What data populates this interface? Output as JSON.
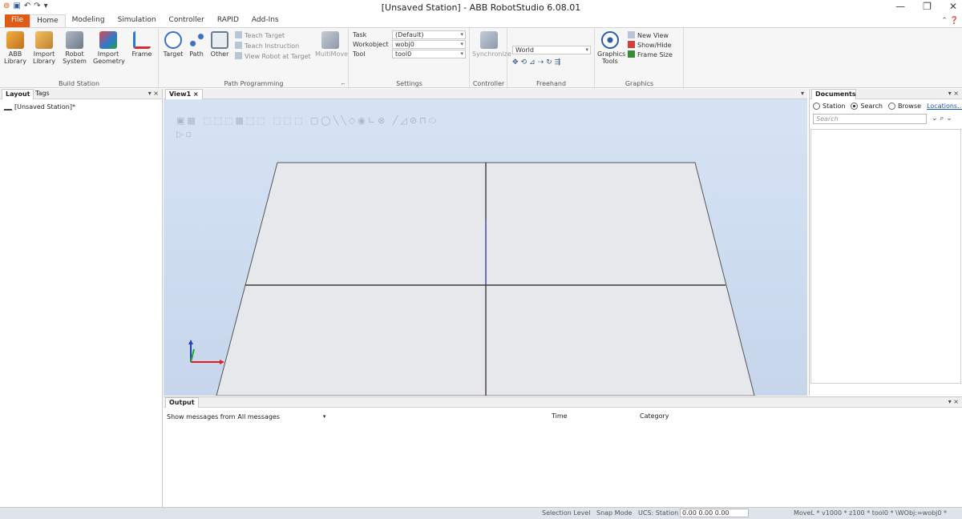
{
  "window": {
    "title": "[Unsaved Station] - ABB RobotStudio 6.08.01",
    "qat_icons": [
      "app-icon",
      "save-icon",
      "undo-icon",
      "redo-icon",
      "customize-icon"
    ],
    "controls": {
      "minimize": "—",
      "restore": "❐",
      "close": "✕"
    }
  },
  "tabs": [
    {
      "label": "File"
    },
    {
      "label": "Home"
    },
    {
      "label": "Modeling"
    },
    {
      "label": "Simulation"
    },
    {
      "label": "Controller"
    },
    {
      "label": "RAPID"
    },
    {
      "label": "Add-Ins"
    }
  ],
  "help_glyph": "⌃ ❓",
  "ribbon": {
    "build_station": {
      "label": "Build Station",
      "abb_library": "ABB Library",
      "import_library": "Import Library",
      "robot_system": "Robot System",
      "import_geometry": "Import Geometry",
      "frame": "Frame"
    },
    "path_programming": {
      "label": "Path Programming",
      "target": "Target",
      "path": "Path",
      "other": "Other",
      "teach_target": "Teach Target",
      "teach_instruction": "Teach Instruction",
      "view_robot_at_target": "View Robot at Target",
      "multimove": "MultiMove",
      "launcher": "⌐"
    },
    "settings": {
      "label": "Settings",
      "task": "Task",
      "workobject": "Workobject",
      "tool": "Tool",
      "task_value": "(Default)",
      "workobject_value": "wobj0",
      "tool_value": "tool0"
    },
    "controller": {
      "label": "Controller",
      "synchronize": "Synchronize"
    },
    "freehand": {
      "label": "Freehand",
      "reference_value": "World"
    },
    "graphics": {
      "label": "Graphics",
      "graphics_tools": "Graphics Tools",
      "new_view": "New View",
      "show_hide": "Show/Hide",
      "frame_size": "Frame Size"
    }
  },
  "layout_panel": {
    "tabs": [
      "Layout",
      "Tags"
    ],
    "pin": "▾ ×",
    "tree_item": "[Unsaved Station]*"
  },
  "view_panel": {
    "tab": "View1",
    "close": "×",
    "menu": "▾"
  },
  "documents_panel": {
    "tab": "Documents",
    "pin": "▾ ×",
    "radio_station": "Station",
    "radio_search": "Search",
    "radio_browse": "Browse",
    "locations_link": "Locations...",
    "search_placeholder": "Search",
    "search_icons": "⌄  ⌕  ⌄"
  },
  "output_panel": {
    "tab": "Output",
    "pin": "▾ ×",
    "show_messages_label": "Show messages from",
    "filter_value": "All messages",
    "columns": [
      "Time",
      "Category"
    ]
  },
  "statusbar": {
    "selection_level": "Selection Level",
    "snap_mode": "Snap Mode",
    "ucs": "UCS: Station",
    "coords": "0.00  0.00  0.00",
    "move_settings": "MoveL  *  v1000  *  z100  *  tool0  *  \\WObj:=wobj0  *"
  },
  "colors": {
    "file_tab": "#e05b15",
    "viewport_top": "#d6e3f4",
    "axis_x": "#e02020",
    "axis_y": "#1fa81f",
    "axis_z": "#1f3fd0"
  }
}
